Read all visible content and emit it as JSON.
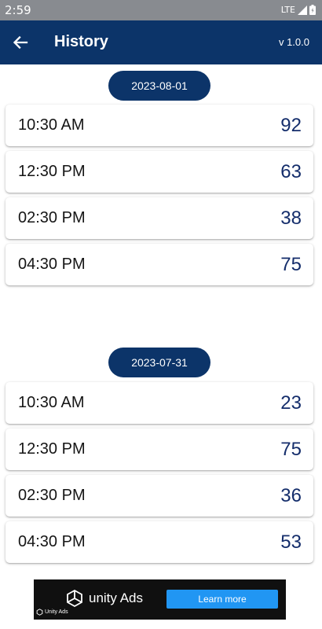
{
  "status_bar": {
    "time": "2:59",
    "network": "LTE"
  },
  "app_bar": {
    "title": "History",
    "version": "v 1.0.0"
  },
  "groups": [
    {
      "date": "2023-08-01",
      "entries": [
        {
          "time": "10:30 AM",
          "value": "92"
        },
        {
          "time": "12:30 PM",
          "value": "63"
        },
        {
          "time": "02:30 PM",
          "value": "38"
        },
        {
          "time": "04:30 PM",
          "value": "75"
        }
      ]
    },
    {
      "date": "2023-07-31",
      "entries": [
        {
          "time": "10:30 AM",
          "value": "23"
        },
        {
          "time": "12:30 PM",
          "value": "75"
        },
        {
          "time": "02:30 PM",
          "value": "36"
        },
        {
          "time": "04:30 PM",
          "value": "53"
        }
      ]
    }
  ],
  "ad": {
    "brand": "unity Ads",
    "cta": "Learn more",
    "corner_label": "Unity Ads"
  },
  "colors": {
    "primary": "#0c3469",
    "value_text": "#142d6b",
    "ad_button": "#2196f3"
  }
}
